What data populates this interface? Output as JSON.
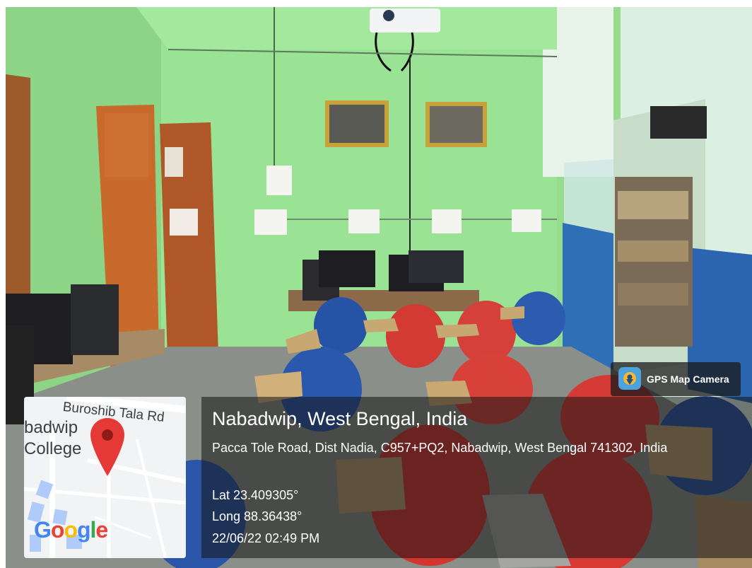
{
  "overlay": {
    "app_badge": "GPS Map Camera",
    "title": "Nabadwip, West Bengal, India",
    "address": "Pacca Tole Road, Dist Nadia, C957+PQ2, Nabadwip, West Bengal 741302, India",
    "lat": "Lat 23.409305°",
    "long": "Long 88.36438°",
    "datetime": "22/06/22 02:49 PM"
  },
  "map": {
    "road_label": "Buroshib Tala Rd",
    "area_line1": "badwip",
    "area_line2": "College",
    "logo": [
      "G",
      "o",
      "o",
      "g",
      "l",
      "e"
    ],
    "logo_colors": [
      "#4285F4",
      "#EA4335",
      "#FBBC05",
      "#4285F4",
      "#34A853",
      "#EA4335"
    ],
    "pin_color": "#E53935"
  },
  "icons": {
    "map_pin": "location-pin-icon",
    "camera_badge": "gps-camera-app-icon"
  }
}
